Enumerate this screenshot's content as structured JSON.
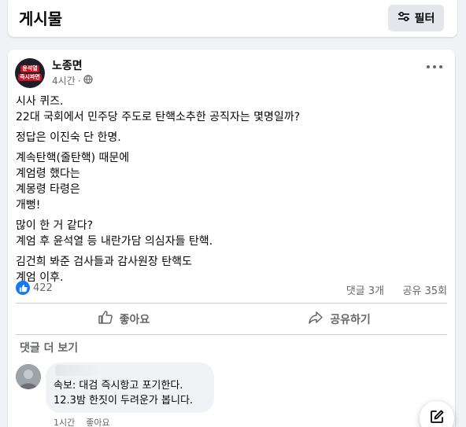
{
  "header": {
    "title": "게시물",
    "filter_label": "필터"
  },
  "post": {
    "author": "노종면",
    "time": "4시간",
    "avatar_text": [
      "윤석열",
      "즉시파면"
    ],
    "paragraphs": [
      [
        "시사 퀴즈.",
        "22대 국회에서 민주당 주도로 탄핵소추한 공직자는 몇명일까?"
      ],
      [
        "정답은 이진숙 단 한명."
      ],
      [
        "계속탄핵(줄탄핵) 때문에",
        "계엄령 했다는",
        "계몽령 타령은",
        "개뻥!"
      ],
      [
        "많이 한 거 같다?",
        "계엄 후 윤석열 등 내란가담 의심자들 탄핵."
      ],
      [
        "김건희 봐준 검사들과 감사원장 탄핵도",
        "계엄 이후."
      ]
    ],
    "like_count": "422",
    "comments_stat": "댓글 3개",
    "shares_stat": "공유 35회",
    "like_label": "좋아요",
    "share_label": "공유하기"
  },
  "comments": {
    "more_label": "댓글 더 보기",
    "items": [
      {
        "lines": [
          "속보: 대검 즉시항고 포기한다.",
          "12.3밤 한짓이 두려운가 봅니다."
        ],
        "time": "1시간",
        "like": "좋아요"
      }
    ]
  },
  "colors": {
    "accent": "#1877f2",
    "badge_red": "#c8141e"
  }
}
